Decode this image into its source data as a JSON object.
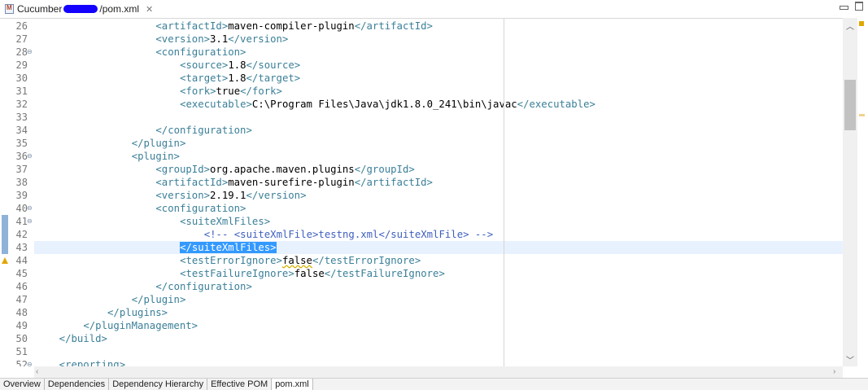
{
  "editor_tab": {
    "title_prefix": "Cucumber",
    "title_suffix": "/pom.xml",
    "close_glyph": "✕",
    "icon": "maven-file-icon"
  },
  "lines": [
    {
      "num": "26",
      "indent": 20,
      "parts": [
        [
          "t",
          "<artifactId>"
        ],
        [
          "x",
          "maven-compiler-plugin"
        ],
        [
          "t",
          "</artifactId>"
        ]
      ]
    },
    {
      "num": "27",
      "indent": 20,
      "parts": [
        [
          "t",
          "<version>"
        ],
        [
          "x",
          "3.1"
        ],
        [
          "t",
          "</version>"
        ]
      ]
    },
    {
      "num": "28",
      "indent": 20,
      "fold": true,
      "parts": [
        [
          "t",
          "<configuration>"
        ]
      ]
    },
    {
      "num": "29",
      "indent": 24,
      "parts": [
        [
          "t",
          "<source>"
        ],
        [
          "x",
          "1.8"
        ],
        [
          "t",
          "</source>"
        ]
      ]
    },
    {
      "num": "30",
      "indent": 24,
      "parts": [
        [
          "t",
          "<target>"
        ],
        [
          "x",
          "1.8"
        ],
        [
          "t",
          "</target>"
        ]
      ]
    },
    {
      "num": "31",
      "indent": 24,
      "parts": [
        [
          "t",
          "<fork>"
        ],
        [
          "x",
          "true"
        ],
        [
          "t",
          "</fork>"
        ]
      ]
    },
    {
      "num": "32",
      "indent": 24,
      "parts": [
        [
          "t",
          "<executable>"
        ],
        [
          "x",
          "C:\\Program Files\\Java\\jdk1.8.0_241\\bin\\javac"
        ],
        [
          "t",
          "</executable>"
        ]
      ]
    },
    {
      "num": "33",
      "indent": 0,
      "parts": []
    },
    {
      "num": "34",
      "indent": 20,
      "parts": [
        [
          "t",
          "</configuration>"
        ]
      ]
    },
    {
      "num": "35",
      "indent": 16,
      "parts": [
        [
          "t",
          "</plugin>"
        ]
      ]
    },
    {
      "num": "36",
      "indent": 16,
      "fold": true,
      "parts": [
        [
          "t",
          "<plugin>"
        ]
      ]
    },
    {
      "num": "37",
      "indent": 20,
      "parts": [
        [
          "t",
          "<groupId>"
        ],
        [
          "x",
          "org.apache.maven.plugins"
        ],
        [
          "t",
          "</groupId>"
        ]
      ]
    },
    {
      "num": "38",
      "indent": 20,
      "parts": [
        [
          "t",
          "<artifactId>"
        ],
        [
          "x",
          "maven-surefire-plugin"
        ],
        [
          "t",
          "</artifactId>"
        ]
      ]
    },
    {
      "num": "39",
      "indent": 20,
      "parts": [
        [
          "t",
          "<version>"
        ],
        [
          "x",
          "2.19.1"
        ],
        [
          "t",
          "</version>"
        ]
      ]
    },
    {
      "num": "40",
      "indent": 20,
      "fold": true,
      "parts": [
        [
          "t",
          "<configuration>"
        ]
      ]
    },
    {
      "num": "41",
      "indent": 24,
      "fold": true,
      "parts": [
        [
          "t",
          "<suiteXmlFiles>"
        ]
      ]
    },
    {
      "num": "42",
      "indent": 28,
      "parts": [
        [
          "cm",
          "<!-- <suiteXmlFile>testng.xml</suiteXmlFile> -->"
        ]
      ]
    },
    {
      "num": "43",
      "indent": 24,
      "current": true,
      "parts": [
        [
          "sel",
          "</suiteXmlFiles>"
        ]
      ]
    },
    {
      "num": "44",
      "indent": 24,
      "warning": true,
      "parts": [
        [
          "t",
          "<testErrorIgnore>"
        ],
        [
          "xs",
          "false"
        ],
        [
          "t",
          "</testErrorIgnore>"
        ]
      ]
    },
    {
      "num": "45",
      "indent": 24,
      "parts": [
        [
          "t",
          "<testFailureIgnore>"
        ],
        [
          "x",
          "false"
        ],
        [
          "t",
          "</testFailureIgnore>"
        ]
      ]
    },
    {
      "num": "46",
      "indent": 20,
      "parts": [
        [
          "t",
          "</configuration>"
        ]
      ]
    },
    {
      "num": "47",
      "indent": 16,
      "parts": [
        [
          "t",
          "</plugin>"
        ]
      ]
    },
    {
      "num": "48",
      "indent": 12,
      "parts": [
        [
          "t",
          "</plugins>"
        ]
      ]
    },
    {
      "num": "49",
      "indent": 8,
      "parts": [
        [
          "t",
          "</pluginManagement>"
        ]
      ]
    },
    {
      "num": "50",
      "indent": 4,
      "parts": [
        [
          "t",
          "</build>"
        ]
      ]
    },
    {
      "num": "51",
      "indent": 0,
      "parts": []
    },
    {
      "num": "52",
      "indent": 4,
      "fold": true,
      "parts": [
        [
          "t",
          "<reporting>"
        ]
      ]
    }
  ],
  "bottom_tabs": [
    {
      "label": "Overview",
      "active": false
    },
    {
      "label": "Dependencies",
      "active": false
    },
    {
      "label": "Dependency Hierarchy",
      "active": false
    },
    {
      "label": "Effective POM",
      "active": false
    },
    {
      "label": "pom.xml",
      "active": true
    }
  ],
  "colors": {
    "tag": "#3a7f98",
    "text": "#000000",
    "comment": "#3f5fbf",
    "selection": "#3399ff",
    "current_line": "#e8f2fe",
    "warning": "#e0a800"
  }
}
